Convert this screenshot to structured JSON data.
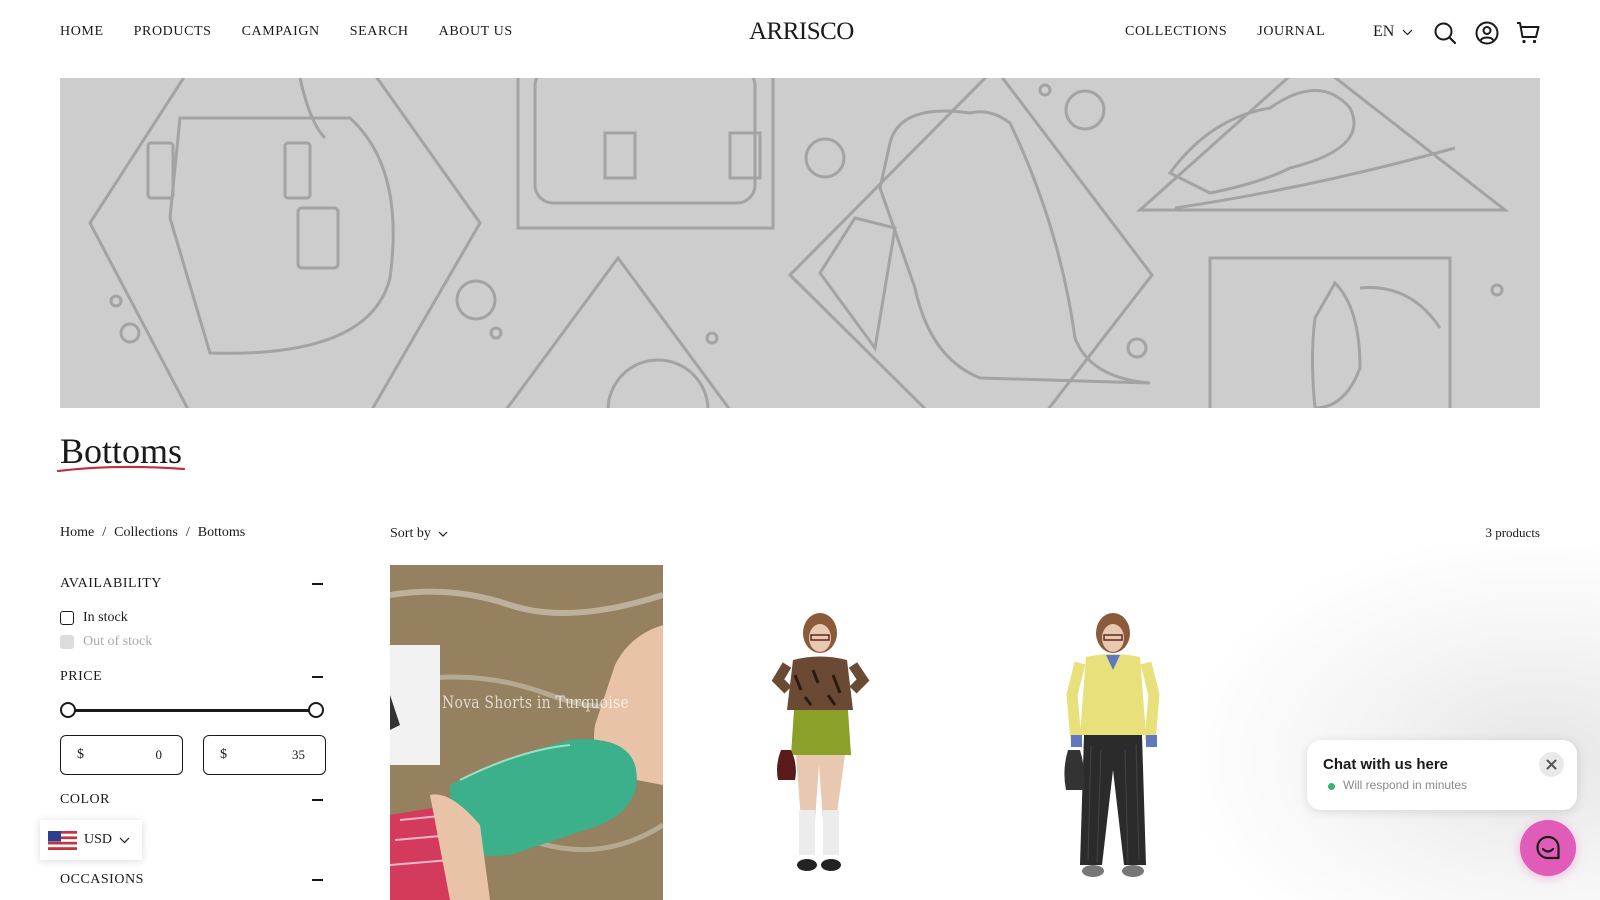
{
  "header": {
    "nav_left": [
      "HOME",
      "PRODUCTS",
      "CAMPAIGN",
      "SEARCH",
      "ABOUT US"
    ],
    "logo": "ARRISCO",
    "nav_right": [
      "COLLECTIONS",
      "JOURNAL"
    ],
    "language": "EN",
    "icons": [
      "search-icon",
      "account-icon",
      "cart-icon"
    ]
  },
  "page": {
    "title": "Bottoms",
    "breadcrumb": [
      "Home",
      "Collections",
      "Bottoms"
    ],
    "breadcrumb_separator": "/",
    "sort_label": "Sort by",
    "product_count": "3 products"
  },
  "filters": {
    "availability": {
      "label": "AVAILABILITY",
      "options": [
        {
          "label": "In stock",
          "enabled": true
        },
        {
          "label": "Out of stock",
          "enabled": false
        }
      ]
    },
    "price": {
      "label": "PRICE",
      "currency_symbol": "$",
      "min_value": "0",
      "max_value": "35"
    },
    "color": {
      "label": "COLOR"
    },
    "occasions": {
      "label": "OCCASIONS"
    }
  },
  "currency_widget": {
    "code": "USD"
  },
  "products": [
    {
      "image_caption": "Nova Shorts in Turquoise"
    },
    {
      "image_caption": ""
    },
    {
      "image_caption": ""
    }
  ],
  "chat": {
    "title": "Chat with us here",
    "status": "Will respond in minutes"
  },
  "colors": {
    "banner_bg": "#cdcdcd",
    "banner_line": "#a3a3a3",
    "title_underline": "#c0303c",
    "chat_bubble": "#e05cb8",
    "status_dot": "#3bb36b"
  }
}
